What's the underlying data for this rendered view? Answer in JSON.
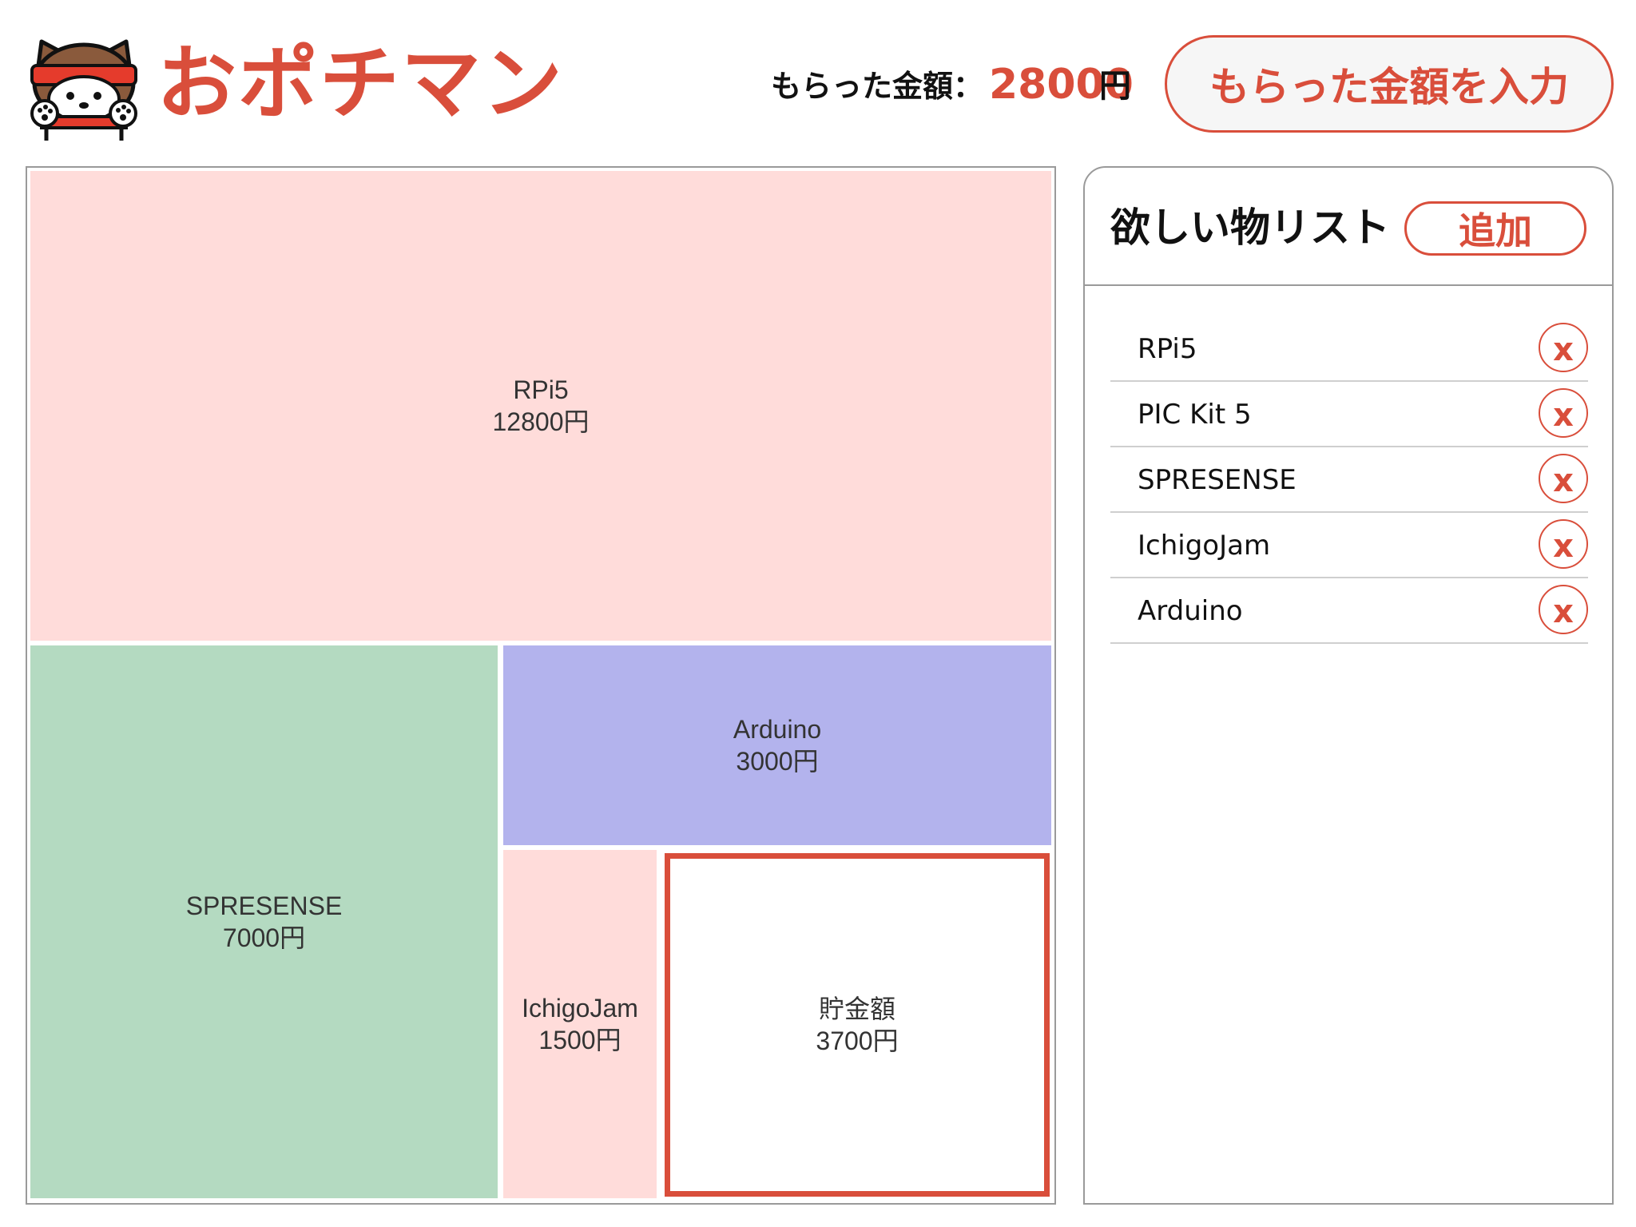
{
  "app": {
    "title": "おポチマン",
    "logo_icon": "shiba-dog-mascot-icon"
  },
  "header": {
    "amount_label": "もらった金額：",
    "amount_value": "28000",
    "amount_unit": "円",
    "enter_button_label": "もらった金額を入力"
  },
  "colors": {
    "accent": "#d94e3b",
    "pink": "#ffdcda",
    "green": "#b4dac1",
    "blue": "#b3b3ed",
    "savings_border": "#d94e3b"
  },
  "treemap": {
    "cells": [
      {
        "name": "RPi5",
        "amount": 12800,
        "value_label": "12800円",
        "color": "#ffdcda"
      },
      {
        "name": "SPRESENSE",
        "amount": 7000,
        "value_label": "7000円",
        "color": "#b4dac1"
      },
      {
        "name": "Arduino",
        "amount": 3000,
        "value_label": "3000円",
        "color": "#b3b3ed"
      },
      {
        "name": "IchigoJam",
        "amount": 1500,
        "value_label": "1500円",
        "color": "#ffdcda"
      },
      {
        "name": "貯金額",
        "amount": 3700,
        "value_label": "3700円",
        "color": "#ffffff",
        "highlight": true
      }
    ]
  },
  "wishlist": {
    "title": "欲しい物リスト",
    "add_button_label": "追加",
    "delete_label": "x",
    "items": [
      {
        "label": "RPi5"
      },
      {
        "label": "PIC Kit 5"
      },
      {
        "label": "SPRESENSE"
      },
      {
        "label": "IchigoJam"
      },
      {
        "label": "Arduino"
      }
    ]
  }
}
